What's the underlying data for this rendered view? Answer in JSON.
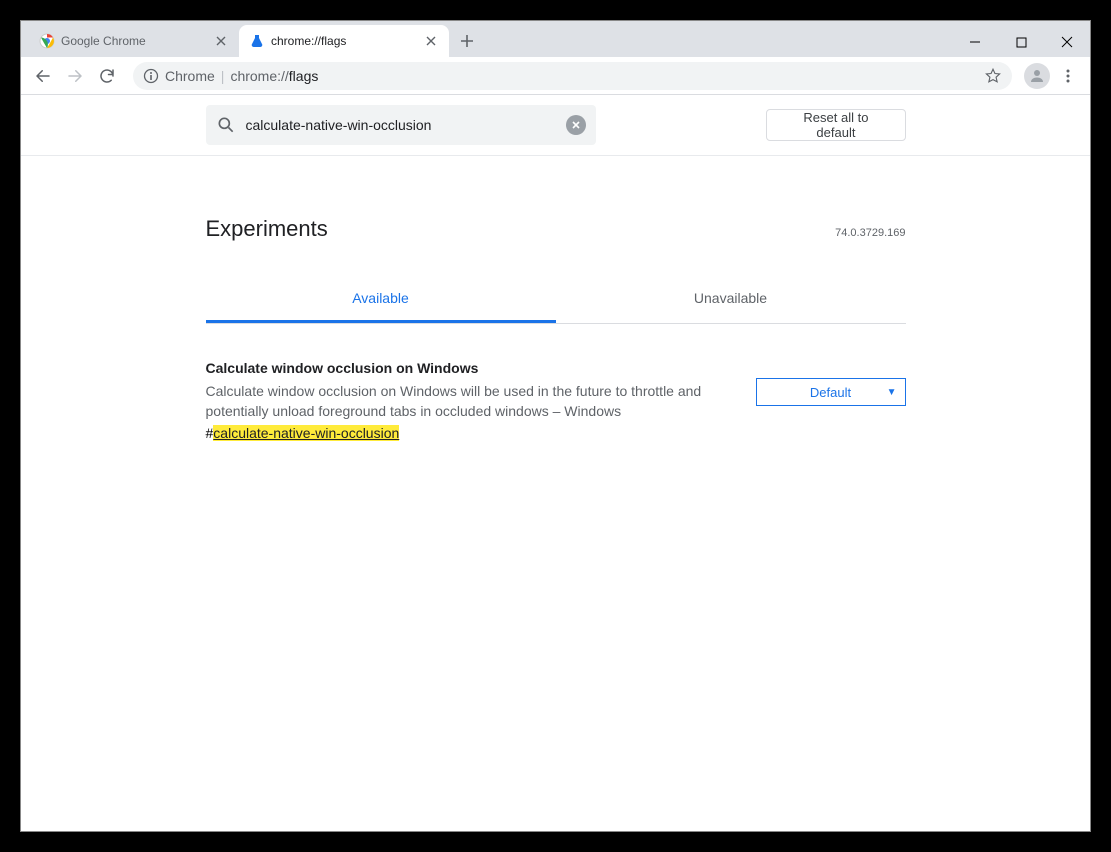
{
  "tabs": [
    {
      "title": "Google Chrome",
      "active": false
    },
    {
      "title": "chrome://flags",
      "active": true
    }
  ],
  "omnibox": {
    "prefix": "Chrome",
    "sep": "|",
    "url_dim": "chrome://",
    "url_bold": "flags"
  },
  "flags_page": {
    "search_value": "calculate-native-win-occlusion",
    "reset_label": "Reset all to default",
    "heading": "Experiments",
    "version": "74.0.3729.169",
    "tabs": [
      {
        "label": "Available",
        "active": true
      },
      {
        "label": "Unavailable",
        "active": false
      }
    ],
    "flag": {
      "title": "Calculate window occlusion on Windows",
      "desc": "Calculate window occlusion on Windows will be used in the future to throttle and potentially unload foreground tabs in occluded windows – Windows",
      "anchor_hash": "#",
      "anchor_text": "calculate-native-win-occlusion",
      "select_value": "Default"
    }
  }
}
